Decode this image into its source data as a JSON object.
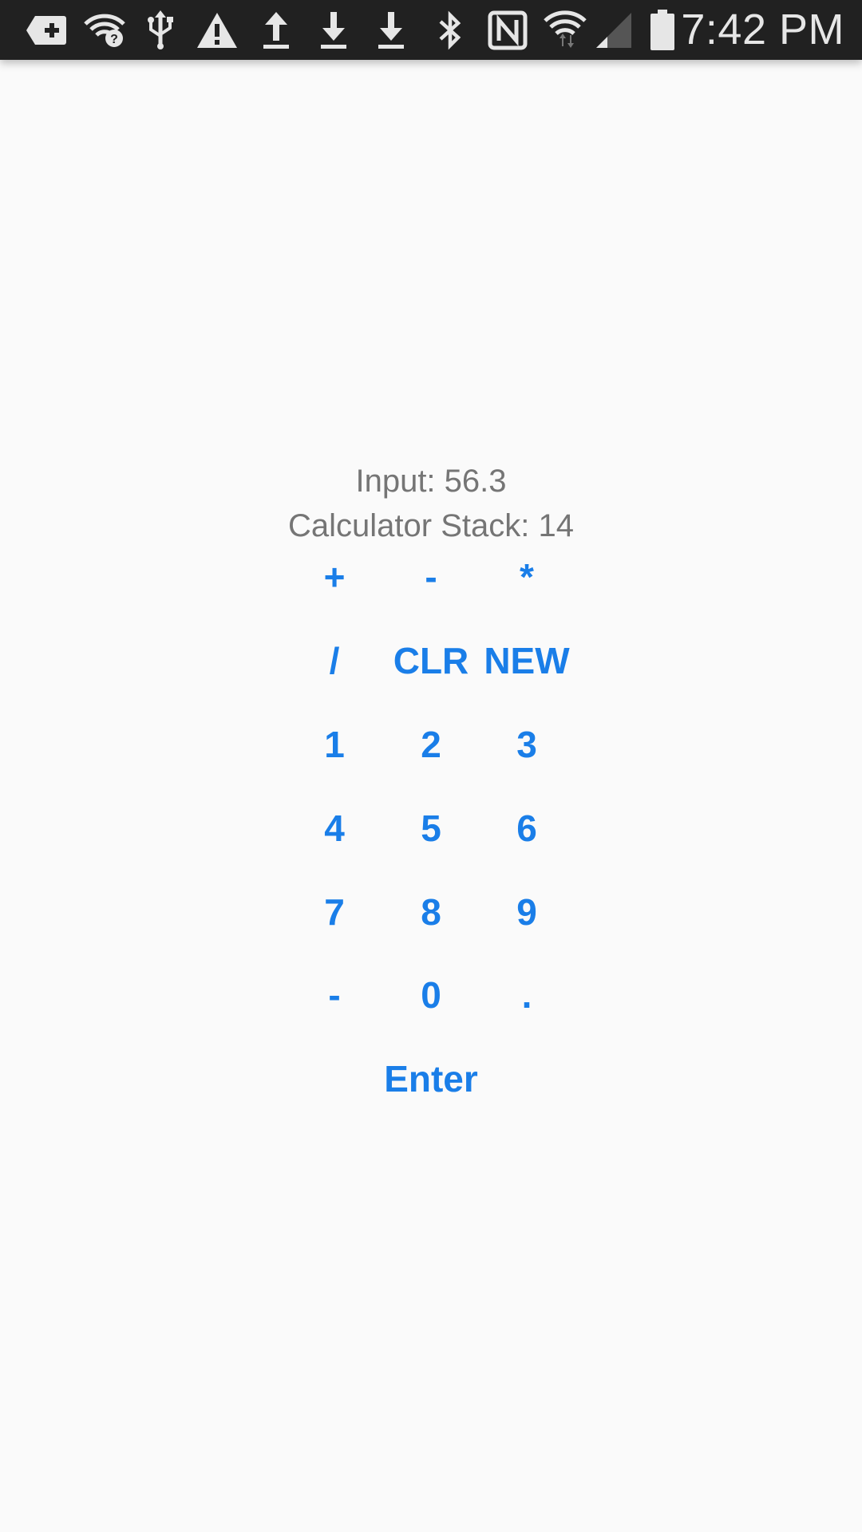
{
  "status_bar": {
    "icons": [
      "add-notification-icon",
      "wifi-question-icon",
      "usb-icon",
      "warning-icon",
      "upload-icon",
      "download-icon",
      "download-icon",
      "bluetooth-icon",
      "nfc-icon",
      "wifi-data-icon",
      "cell-signal-icon",
      "battery-icon"
    ],
    "time": "7:42 PM"
  },
  "calculator": {
    "input_text": "Input: 56.3",
    "stack_text": "Calculator Stack: 14",
    "keys": {
      "plus": "+",
      "minus": "-",
      "multiply": "*",
      "divide": "/",
      "clear": "CLR",
      "new": "NEW",
      "one": "1",
      "two": "2",
      "three": "3",
      "four": "4",
      "five": "5",
      "six": "6",
      "seven": "7",
      "eight": "8",
      "nine": "9",
      "negate": "-",
      "zero": "0",
      "decimal": ".",
      "enter": "Enter"
    }
  },
  "colors": {
    "accent": "#1a7ee8",
    "text_secondary": "#757575",
    "status_bar_bg": "#212121",
    "background": "#fafafa"
  }
}
